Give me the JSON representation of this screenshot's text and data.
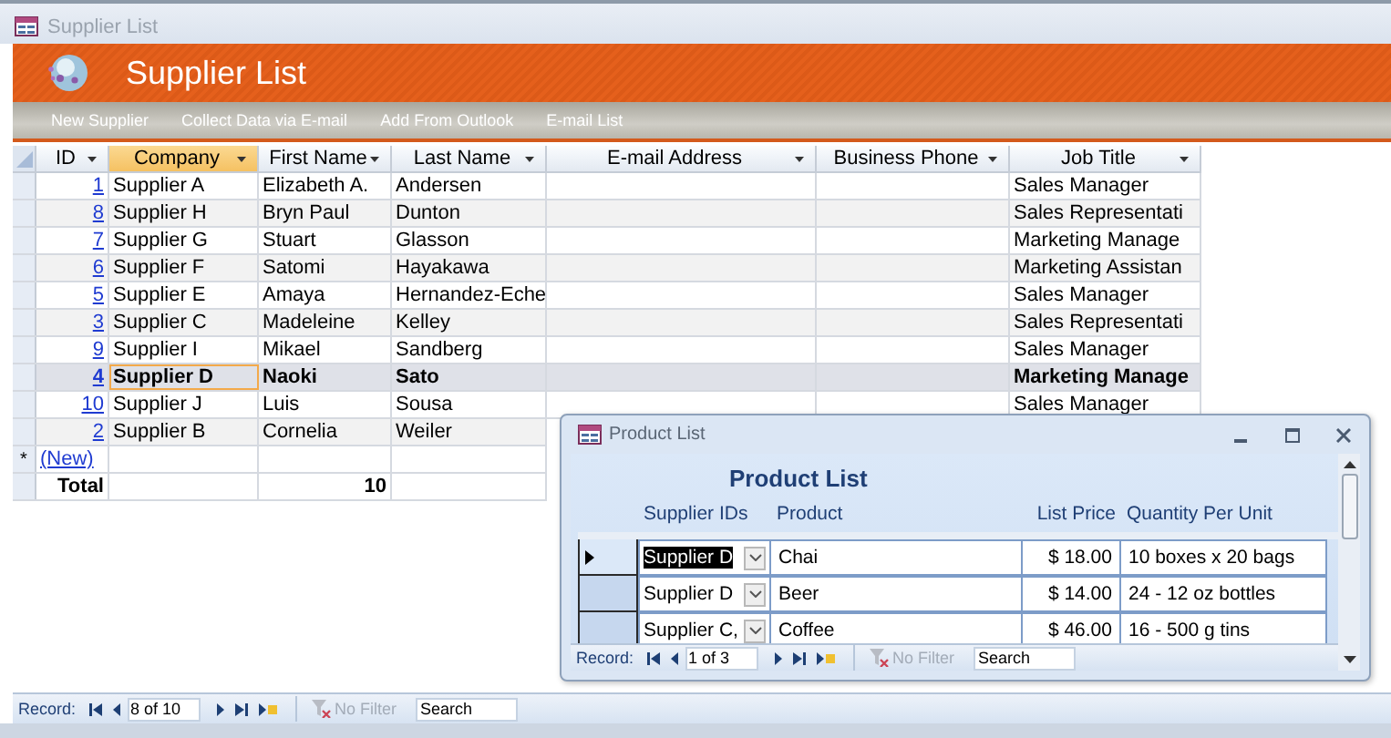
{
  "window": {
    "title": "Supplier List"
  },
  "header": {
    "title": "Supplier List"
  },
  "toolbar": [
    "New Supplier",
    "Collect Data via E-mail",
    "Add From Outlook",
    "E-mail List"
  ],
  "table": {
    "columns": [
      {
        "label": "ID",
        "selected": false
      },
      {
        "label": "Company",
        "selected": true
      },
      {
        "label": "First Name",
        "selected": false
      },
      {
        "label": "Last Name",
        "selected": false
      },
      {
        "label": "E-mail Address",
        "selected": false
      },
      {
        "label": "Business Phone",
        "selected": false
      },
      {
        "label": "Job Title",
        "selected": false
      }
    ],
    "rows": [
      {
        "id": "1",
        "company": "Supplier A",
        "first_name": "Elizabeth A.",
        "last_name": "Andersen",
        "job_title": "Sales Manager",
        "selected": false
      },
      {
        "id": "8",
        "company": "Supplier H",
        "first_name": "Bryn Paul",
        "last_name": "Dunton",
        "job_title": "Sales Representati",
        "selected": false
      },
      {
        "id": "7",
        "company": "Supplier G",
        "first_name": "Stuart",
        "last_name": "Glasson",
        "job_title": "Marketing Manage",
        "selected": false
      },
      {
        "id": "6",
        "company": "Supplier F",
        "first_name": "Satomi",
        "last_name": "Hayakawa",
        "job_title": "Marketing Assistan",
        "selected": false
      },
      {
        "id": "5",
        "company": "Supplier E",
        "first_name": "Amaya",
        "last_name": "Hernandez-Eche",
        "job_title": "Sales Manager",
        "selected": false
      },
      {
        "id": "3",
        "company": "Supplier C",
        "first_name": "Madeleine",
        "last_name": "Kelley",
        "job_title": "Sales Representati",
        "selected": false
      },
      {
        "id": "9",
        "company": "Supplier I",
        "first_name": "Mikael",
        "last_name": "Sandberg",
        "job_title": "Sales Manager",
        "selected": false
      },
      {
        "id": "4",
        "company": "Supplier D",
        "first_name": "Naoki",
        "last_name": "Sato",
        "job_title": "Marketing Manage",
        "selected": true
      },
      {
        "id": "10",
        "company": "Supplier J",
        "first_name": "Luis",
        "last_name": "Sousa",
        "job_title": "Sales Manager",
        "selected": false
      },
      {
        "id": "2",
        "company": "Supplier B",
        "first_name": "Cornelia",
        "last_name": "Weiler",
        "selected": false
      }
    ],
    "new_row": {
      "marker": "*",
      "label": "(New)"
    },
    "total_row": {
      "label": "Total",
      "first_name": "10"
    }
  },
  "record_nav": {
    "label": "Record:",
    "position": "8 of 10",
    "filter": "No Filter",
    "search_placeholder": "Search"
  },
  "product_window": {
    "title": "Product List",
    "heading": "Product List",
    "columns": [
      "Supplier IDs",
      "Product",
      "List Price",
      "Quantity Per Unit"
    ],
    "rows": [
      {
        "supplier": "Supplier D",
        "product": "Chai",
        "price": "$ 18.00",
        "quantity": "10 boxes x 20 bags",
        "selected": true
      },
      {
        "supplier": "Supplier D",
        "product": "Beer",
        "price": "$ 14.00",
        "quantity": "24 - 12 oz bottles",
        "selected": false
      },
      {
        "supplier": "Supplier C,",
        "product": "Coffee",
        "price": "$ 46.00",
        "quantity": "16 - 500 g tins",
        "selected": false
      }
    ],
    "record_nav": {
      "label": "Record:",
      "position": "1 of 3",
      "filter": "No Filter",
      "search_placeholder": "Search"
    }
  }
}
